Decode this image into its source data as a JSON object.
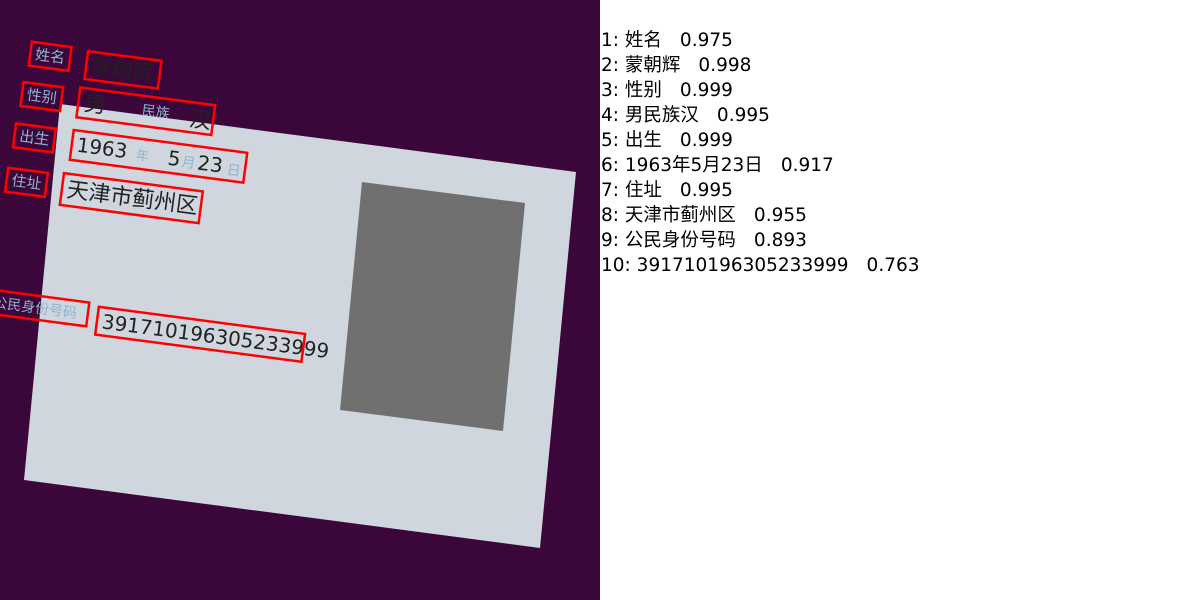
{
  "colors": {
    "background": "#3b073b",
    "card": "#cfd6de",
    "card_label": "#8fb4cf",
    "card_text": "#222222",
    "photo": "#707070",
    "detection_box": "#ff0000",
    "panel": "#ffffff"
  },
  "card": {
    "label_name": "姓名",
    "name": "蒙朝辉",
    "label_gender": "性别",
    "gender": "男",
    "label_ethnicity": "民族",
    "ethnicity": "汉",
    "label_birth": "出生",
    "birth_year": "1963",
    "label_year": "年",
    "birth_month": "5",
    "label_month": "月",
    "birth_day": "23",
    "label_day": "日",
    "label_address": "住址",
    "address": "天津市蓟州区",
    "label_id": "公民身份号码",
    "id_number": "391710196305233999"
  },
  "results": [
    {
      "index": "1:",
      "text": "姓名",
      "score": "0.975"
    },
    {
      "index": "2:",
      "text": "蒙朝辉",
      "score": "0.998"
    },
    {
      "index": "3:",
      "text": "性别",
      "score": "0.999"
    },
    {
      "index": "4:",
      "text": "男民族汉",
      "score": "0.995"
    },
    {
      "index": "5:",
      "text": "出生",
      "score": "0.999"
    },
    {
      "index": "6:",
      "text": "1963年5月23日",
      "score": "0.917"
    },
    {
      "index": "7:",
      "text": "住址",
      "score": "0.995"
    },
    {
      "index": "8:",
      "text": "天津市蓟州区",
      "score": "0.955"
    },
    {
      "index": "9:",
      "text": "公民身份号码",
      "score": "0.893"
    },
    {
      "index": "10:",
      "text": "391710196305233999",
      "score": "0.763"
    }
  ]
}
